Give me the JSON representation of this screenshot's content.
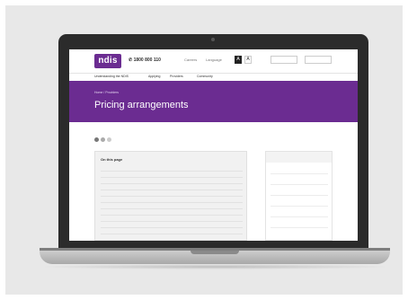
{
  "site": {
    "logo": "ndis",
    "phone": "1800 800 110",
    "utility": [
      "Careers",
      "Language"
    ],
    "text_size_buttons": [
      "A",
      "A"
    ],
    "search_placeholder": "",
    "my_account": ""
  },
  "nav": {
    "items": [
      "Understanding the NDIS",
      "Applying",
      "Providers",
      "Community",
      "",
      "",
      "",
      ""
    ]
  },
  "page": {
    "breadcrumb": "Home / Providers",
    "title": "Pricing arrangements",
    "print_link": ""
  },
  "toc": {
    "heading": "On this page",
    "items": [
      "",
      "",
      "",
      "",
      "",
      "",
      "",
      "",
      "",
      "",
      "",
      "",
      ""
    ]
  },
  "sidebar": {
    "heading": "",
    "links": [
      "",
      "",
      "",
      "",
      "",
      "",
      ""
    ]
  },
  "colors": {
    "brand_purple": "#6b2c91",
    "bezel": "#2b2b2b",
    "backdrop": "#e8e8e8"
  }
}
